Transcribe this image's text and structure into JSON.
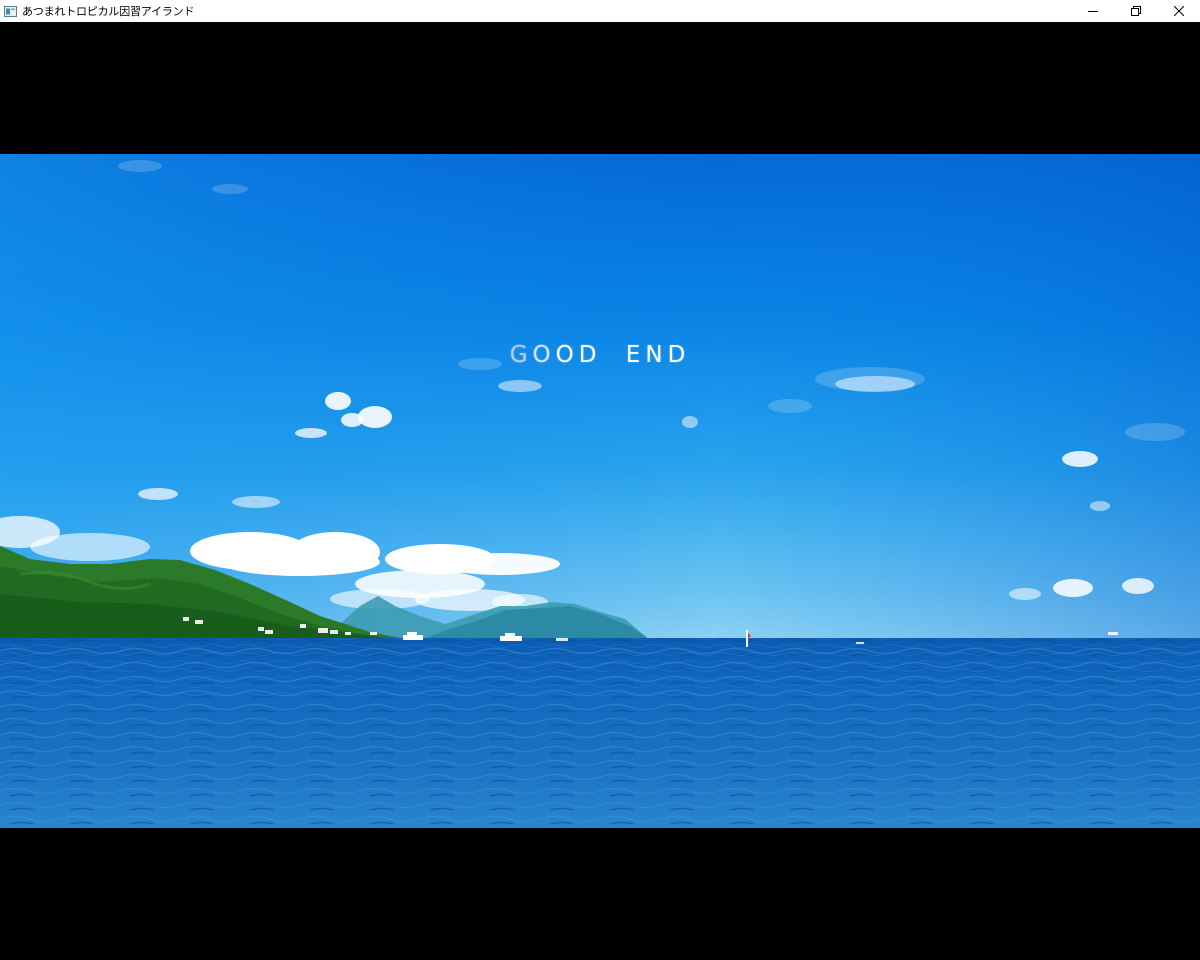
{
  "window": {
    "title": "あつまれトロピカル因習アイランド",
    "controls": {
      "minimize": "minimize-icon",
      "restore": "restore-icon",
      "close": "close-icon"
    }
  },
  "scene": {
    "description_icon": "ocean-background",
    "ending_text": "GOOD END",
    "colors": {
      "sky_top": "#0067d6",
      "sky_horizon": "#6cc4f2",
      "sea_near": "#1d6fbc",
      "sea_far": "#0c5fb4",
      "text": "#ffffff"
    }
  }
}
